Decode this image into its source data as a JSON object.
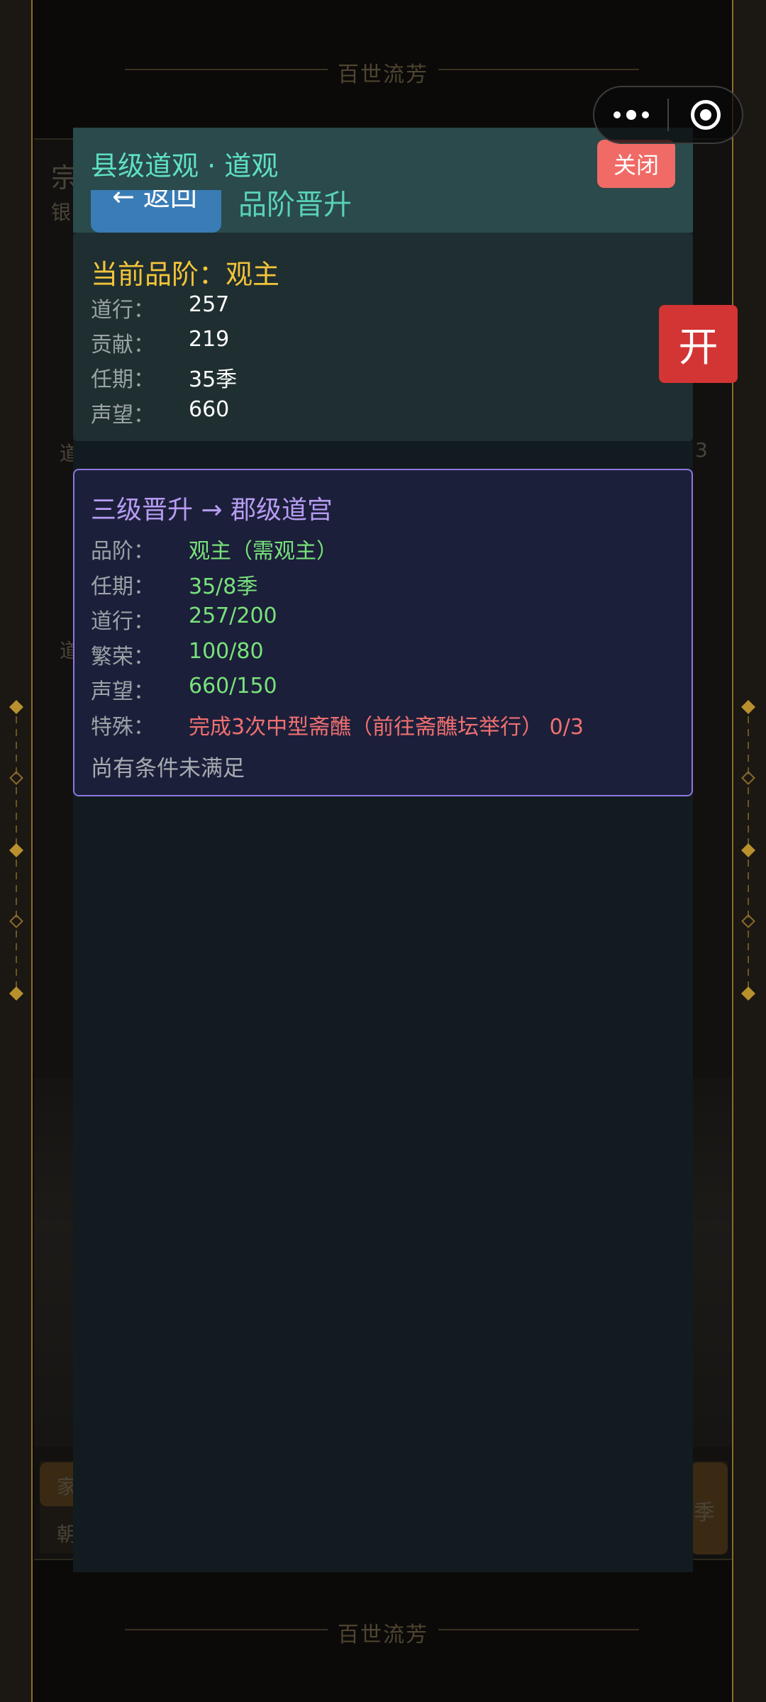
{
  "background": {
    "banner_title": "百世流芳",
    "peek_left_text": [
      "宗",
      "银",
      "道",
      "道",
      "家",
      "朝"
    ],
    "peek_right_text": [
      "3",
      "季"
    ]
  },
  "capsule": {
    "more_icon": "more-dots-icon",
    "close_icon": "target-circle-icon"
  },
  "modal": {
    "title": "县级道观 · 道观",
    "close_label": "关闭",
    "back_label": "← 返回",
    "subtitle": "品阶晋升",
    "current": {
      "title": "当前品阶：观主",
      "rows": [
        {
          "label": "道行：",
          "value": "257"
        },
        {
          "label": "贡献：",
          "value": "219"
        },
        {
          "label": "任期：",
          "value": "35季"
        },
        {
          "label": "声望：",
          "value": "660"
        }
      ]
    },
    "promotion": {
      "title": "三级晋升 → 郡级道宫",
      "rows": [
        {
          "label": "品阶：",
          "value": "观主（需观主）",
          "status": "ok"
        },
        {
          "label": "任期：",
          "value": "35/8季",
          "status": "ok"
        },
        {
          "label": "道行：",
          "value": "257/200",
          "status": "ok"
        },
        {
          "label": "繁荣：",
          "value": "100/80",
          "status": "ok"
        },
        {
          "label": "声望：",
          "value": "660/150",
          "status": "ok"
        },
        {
          "label": "特殊：",
          "value": "完成3次中型斋醮（前往斋醮坛举行） 0/3",
          "status": "bad"
        }
      ],
      "note": "尚有条件未满足"
    }
  },
  "float_button": {
    "label": "开"
  },
  "colors": {
    "accent_teal": "#5fe0c4",
    "current_title": "#f3c43a",
    "promo_border": "#8d78e0",
    "ok": "#78e27a",
    "bad": "#f07070",
    "close_button": "#f06a66",
    "float_button": "#d33434"
  }
}
